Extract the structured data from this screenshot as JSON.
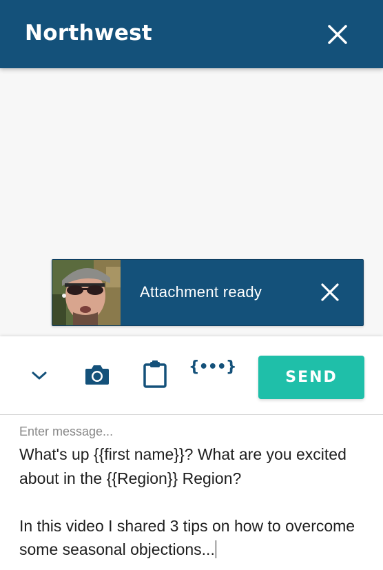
{
  "header": {
    "title": "Northwest",
    "close_icon": "close-icon"
  },
  "attachment": {
    "status_text": "Attachment ready",
    "close_icon": "close-icon"
  },
  "toolbar": {
    "chevron_icon": "chevron-down-icon",
    "camera_icon": "camera-icon",
    "clipboard_icon": "clipboard-icon",
    "variables_icon_text": "{•••}",
    "send_label": "SEND"
  },
  "message": {
    "placeholder": "Enter message...",
    "text": "What's up {{first name}}? What are you excited about in the {{Region}} Region?\n\nIn this video I shared 3 tips on how to overcome some seasonal objections..."
  },
  "colors": {
    "header": "#14517a",
    "accent": "#1fbfa9",
    "background": "#f7f7f7"
  }
}
